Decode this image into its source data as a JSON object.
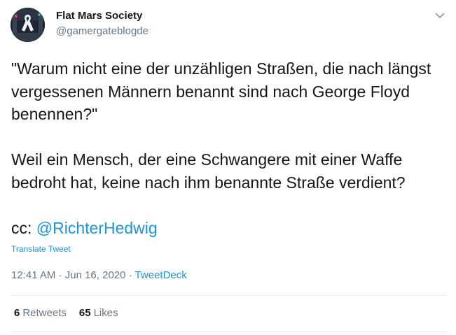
{
  "author": {
    "display_name": "Flat Mars Society",
    "handle": "@gamergateblogde"
  },
  "tweet": {
    "paragraph1": "\"Warum nicht eine der unzähligen Straßen, die nach längst vergessenen Männern benannt sind nach George Floyd benennen?\"",
    "paragraph2": "Weil ein Mensch, der eine Schwangere mit einer Waffe bedroht hat, keine nach ihm benannte Straße verdient?",
    "cc_prefix": "cc: ",
    "mention": "@RichterHedwig",
    "translate_label": "Translate Tweet"
  },
  "meta": {
    "time": "12:41 AM",
    "separator1": " · ",
    "date": "Jun 16, 2020",
    "separator2": " · ",
    "source": "TweetDeck"
  },
  "stats": {
    "retweets_count": "6",
    "retweets_label": "Retweets",
    "likes_count": "65",
    "likes_label": "Likes"
  },
  "icons": {
    "caret": "chevron-down-icon",
    "avatar": "avatar"
  },
  "colors": {
    "link": "#1b95e0",
    "secondary": "#657786",
    "primary": "#14171a",
    "divider": "#e6ecf0"
  }
}
